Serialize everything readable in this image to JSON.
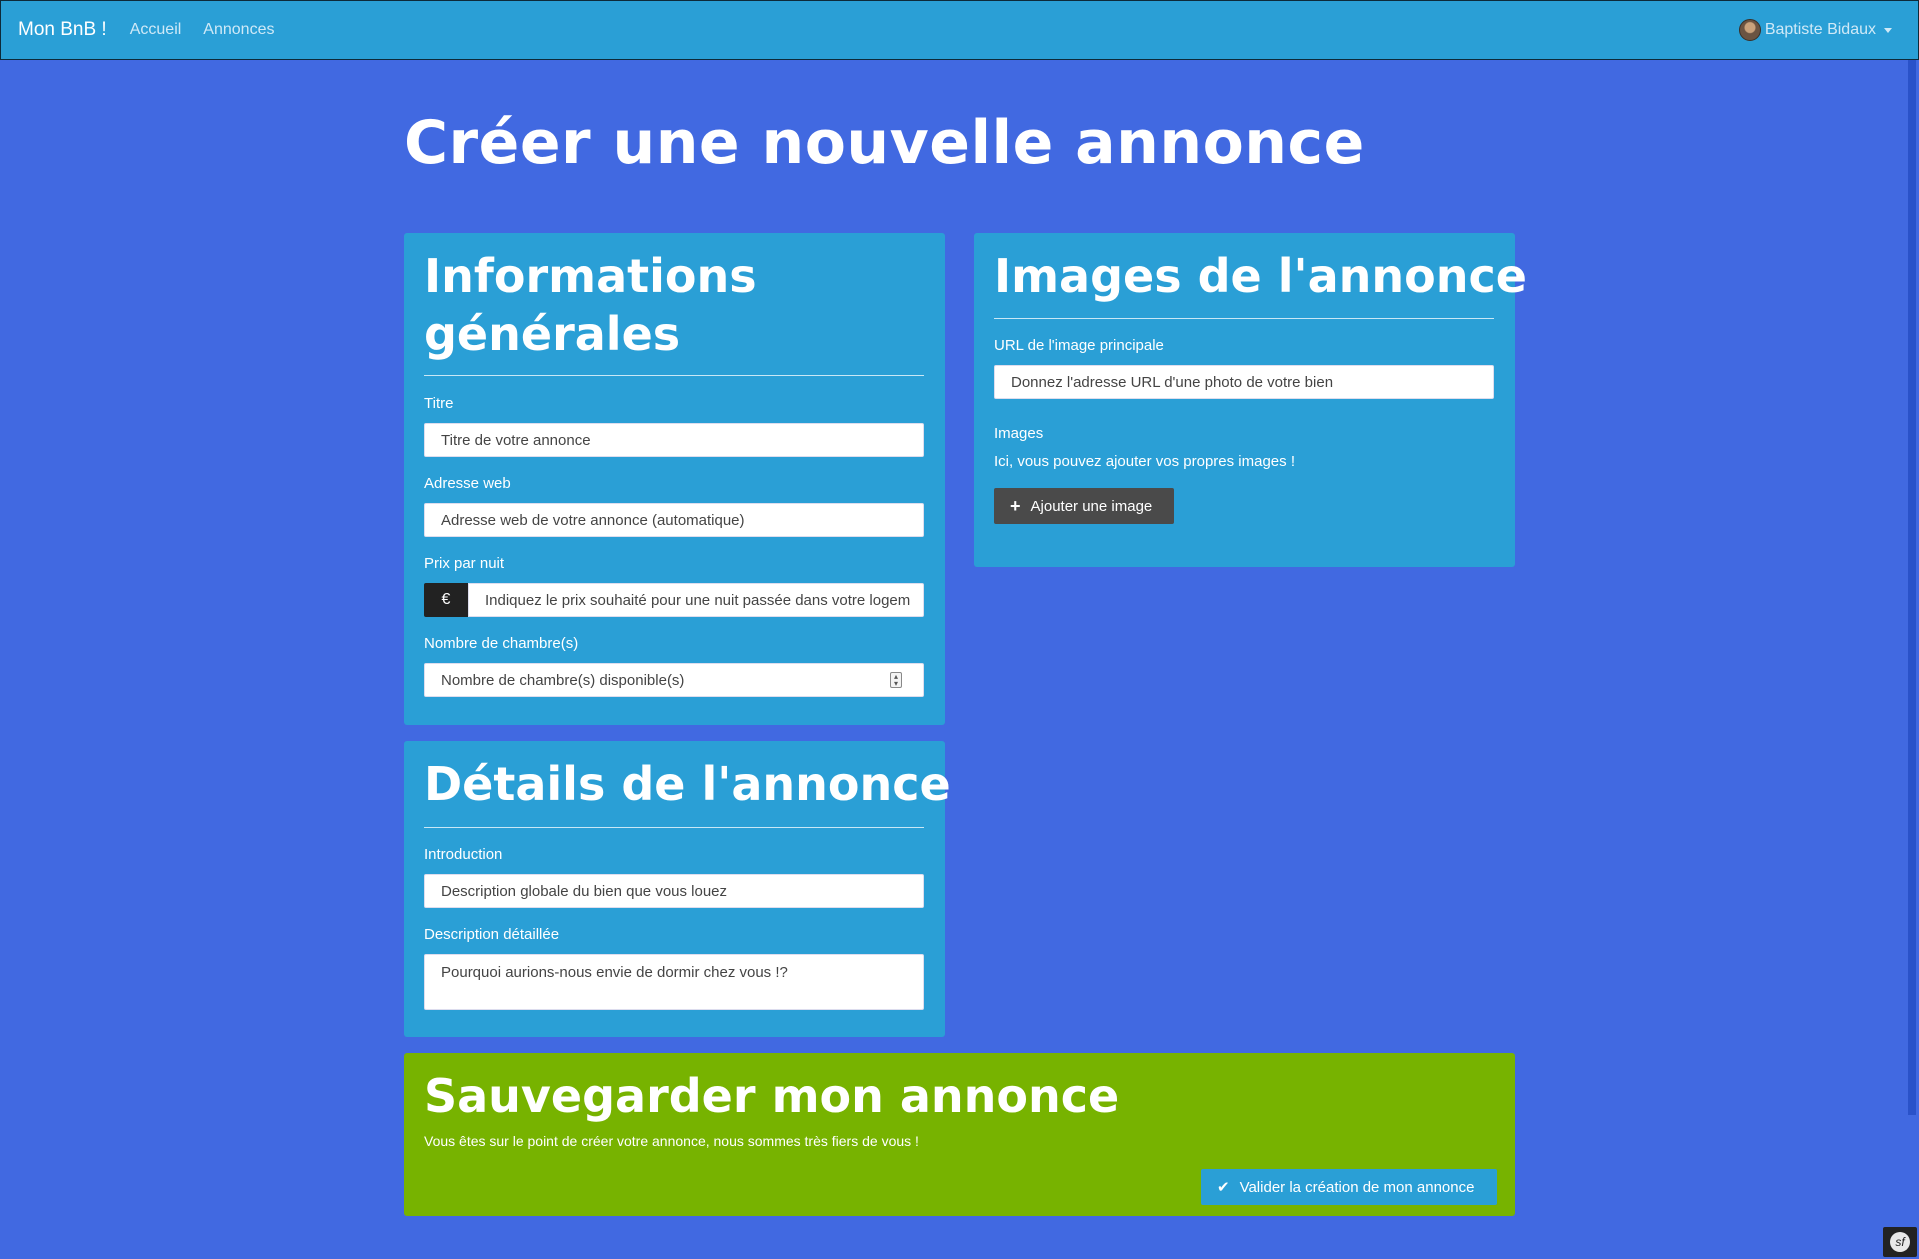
{
  "navbar": {
    "brand": "Mon BnB !",
    "links": [
      "Accueil",
      "Annonces"
    ],
    "user_name": "Baptiste Bidaux"
  },
  "page_title": "Créer une nouvelle annonce",
  "general": {
    "heading": "Informations générales",
    "title_label": "Titre",
    "title_placeholder": "Titre de votre annonce",
    "slug_label": "Adresse web",
    "slug_placeholder": "Adresse web de votre annonce (automatique)",
    "price_label": "Prix par nuit",
    "currency": "€",
    "price_placeholder": "Indiquez le prix souhaité pour une nuit passée dans votre logem",
    "rooms_label": "Nombre de chambre(s)",
    "rooms_placeholder": "Nombre de chambre(s) disponible(s)"
  },
  "images": {
    "heading": "Images de l'annonce",
    "cover_label": "URL de l'image principale",
    "cover_placeholder": "Donnez l'adresse URL d'une photo de votre bien",
    "images_label": "Images",
    "images_help": "Ici, vous pouvez ajouter vos propres images !",
    "add_button": "Ajouter une image"
  },
  "details": {
    "heading": "Détails de l'annonce",
    "intro_label": "Introduction",
    "intro_placeholder": "Description globale du bien que vous louez",
    "content_label": "Description détaillée",
    "content_placeholder": "Pourquoi aurions-nous envie de dormir chez vous !?"
  },
  "save": {
    "heading": "Sauvegarder mon annonce",
    "text": "Vous êtes sur le point de créer votre annonce, nous sommes très fiers de vous !",
    "submit": "Valider la création de mon annonce"
  },
  "colors": {
    "background": "#4169e1",
    "card": "#2a9fd6",
    "save_card": "#77b300",
    "dark_button": "#4a4a4a"
  }
}
